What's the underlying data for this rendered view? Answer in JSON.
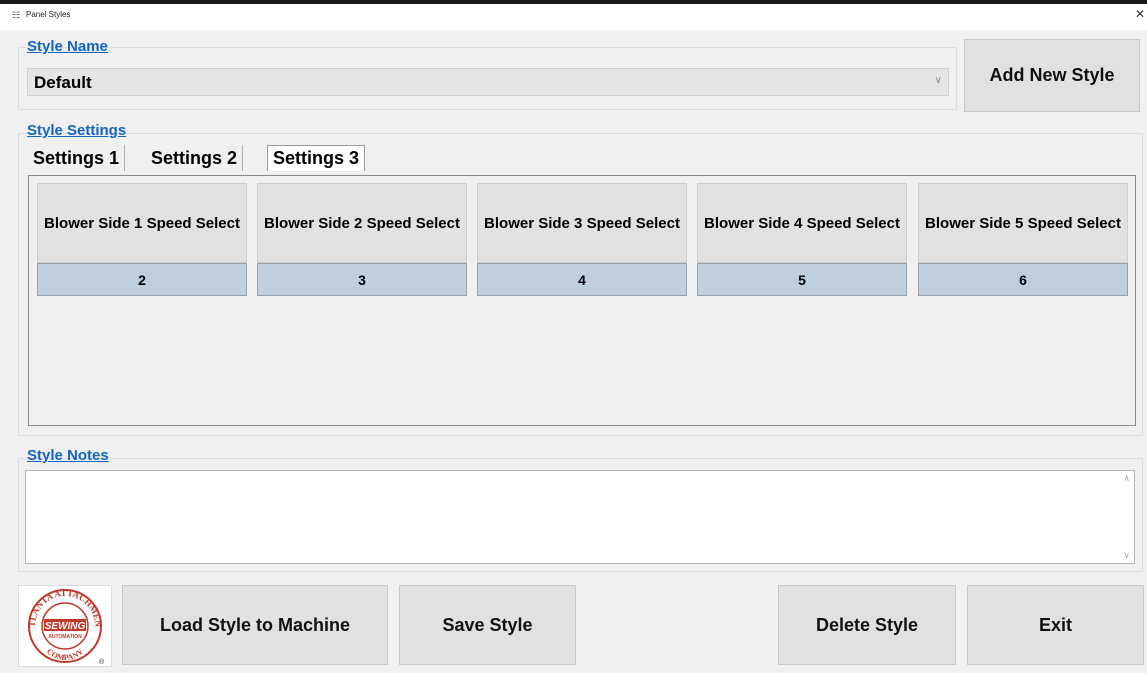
{
  "window": {
    "title": "Panel Styles"
  },
  "style_name": {
    "label": "Style Name",
    "selected": "Default",
    "add_button": "Add New Style"
  },
  "style_settings": {
    "label": "Style Settings",
    "tabs": [
      {
        "label": "Settings 1",
        "selected": false
      },
      {
        "label": "Settings 2",
        "selected": false
      },
      {
        "label": "Settings 3",
        "selected": true
      }
    ],
    "blowers": [
      {
        "label": "Blower Side 1 Speed Select",
        "value": "2"
      },
      {
        "label": "Blower Side 2 Speed Select",
        "value": "3"
      },
      {
        "label": "Blower Side 3 Speed Select",
        "value": "4"
      },
      {
        "label": "Blower Side 4 Speed Select",
        "value": "5"
      },
      {
        "label": "Blower Side 5 Speed Select",
        "value": "6"
      }
    ]
  },
  "style_notes": {
    "label": "Style Notes",
    "value": ""
  },
  "logo": {
    "top_text": "ATLANTA ATTACHMENT",
    "center_text": "SEWING",
    "sub_text": "AUTOMATION",
    "bottom_text": "COMPANY"
  },
  "footer": {
    "load": "Load Style to Machine",
    "save": "Save Style",
    "delete": "Delete Style",
    "exit": "Exit"
  },
  "colors": {
    "group_label": "#1565c0",
    "value_cell": "#c0cfdc",
    "logo_red": "#c0392b"
  }
}
